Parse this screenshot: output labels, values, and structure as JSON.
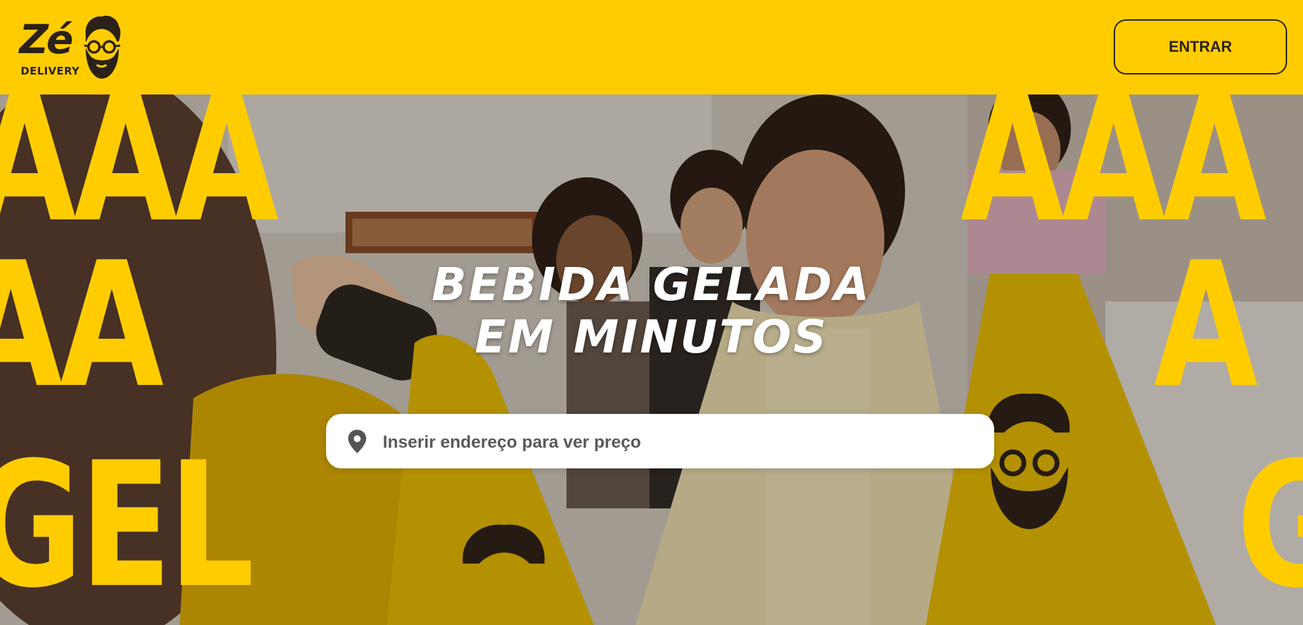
{
  "header": {
    "logo_word": "Zé",
    "logo_sub": "DELIVERY",
    "login_label": "ENTRAR"
  },
  "hero": {
    "title_line1": "BEBIDA GELADA",
    "title_line2": "EM MINUTOS",
    "letters_left_1": "AAA",
    "letters_left_2": "AA",
    "letters_left_3": "GEL",
    "letters_right_1": "AAA",
    "letters_right_2": "A",
    "letters_right_3": "G"
  },
  "search": {
    "placeholder": "Inserir endereço para ver preço",
    "value": ""
  },
  "colors": {
    "brand_yellow": "#ffcc00",
    "brand_dark": "#2b2118",
    "white": "#ffffff"
  },
  "icons": {
    "pin": "location-pin-icon",
    "mascot": "bearded-mascot-icon"
  }
}
